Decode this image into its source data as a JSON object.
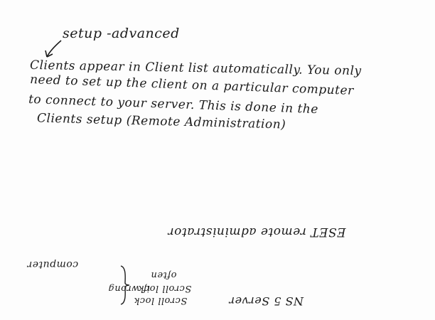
{
  "annotation": "setup -advanced",
  "note_lines": [
    "Clients appear in Client list automatically. You only",
    "need to set up the client on a particular computer",
    "to connect to your server. This is done in the",
    "Clients setup (Remote Administration)"
  ],
  "flipped": {
    "eset": "ESET remote administrator",
    "ns5": "NS 5 Server",
    "scroll_lock_1": "Scroll lock",
    "scroll_lock_2": "Scroll lock",
    "often": "often",
    "if_wrong": "if wrong",
    "computer": "computer"
  },
  "icons": {
    "arrow": "arrow-icon",
    "brace": "brace-icon"
  }
}
